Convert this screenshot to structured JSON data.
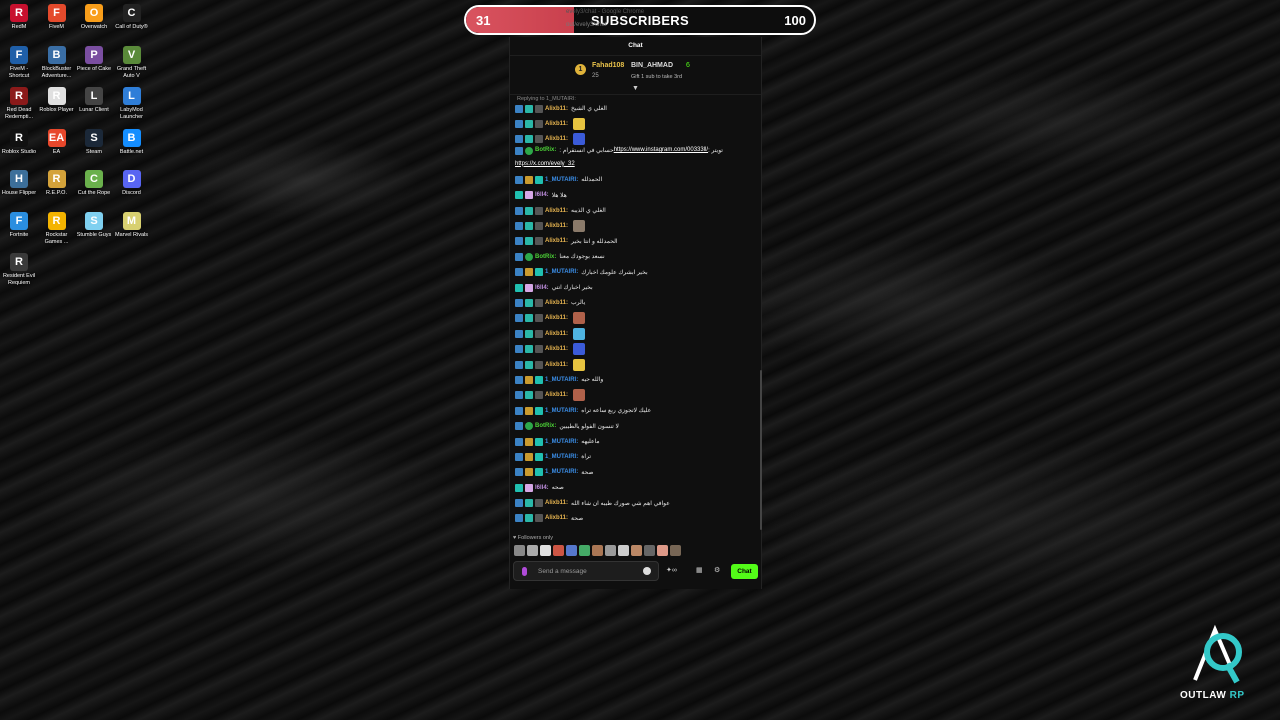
{
  "desktop": [
    {
      "label": "RedM",
      "color": "#c8102e",
      "glyph": "R"
    },
    {
      "label": "FiveM",
      "color": "#e44a2c",
      "glyph": "F"
    },
    {
      "label": "Overwatch",
      "color": "#f99e1a",
      "glyph": "O"
    },
    {
      "label": "Call of Duty®",
      "color": "#222222",
      "glyph": "C"
    },
    {
      "label": "FiveM - Shortcut",
      "color": "#1f5fa8",
      "glyph": "F"
    },
    {
      "label": "BlockBuster Adventure...",
      "color": "#3a6ea5",
      "glyph": "B"
    },
    {
      "label": "Piece of Cake",
      "color": "#7a4ea0",
      "glyph": "P"
    },
    {
      "label": "Grand Theft Auto V",
      "color": "#5a8a3a",
      "glyph": "V"
    },
    {
      "label": "Red Dead Redempti...",
      "color": "#8b1a1a",
      "glyph": "R"
    },
    {
      "label": "Roblox Player",
      "color": "#e0e0e0",
      "glyph": "R"
    },
    {
      "label": "Lunar Client",
      "color": "#444444",
      "glyph": "L"
    },
    {
      "label": "LabyMod Launcher",
      "color": "#2f7ed8",
      "glyph": "L"
    },
    {
      "label": "Roblox Studio",
      "color": "#111111",
      "glyph": "R"
    },
    {
      "label": "EA",
      "color": "#e8472b",
      "glyph": "EA"
    },
    {
      "label": "Steam",
      "color": "#1b2838",
      "glyph": "S"
    },
    {
      "label": "Battle.net",
      "color": "#148eff",
      "glyph": "B"
    },
    {
      "label": "House Flipper",
      "color": "#3c6f9a",
      "glyph": "H"
    },
    {
      "label": "R.E.P.O.",
      "color": "#d4a23a",
      "glyph": "R"
    },
    {
      "label": "Cut the Rope",
      "color": "#6ab04c",
      "glyph": "C"
    },
    {
      "label": "Discord",
      "color": "#5865f2",
      "glyph": "D"
    },
    {
      "label": "Fortnite",
      "color": "#2a8ee0",
      "glyph": "F"
    },
    {
      "label": "Rockstar Games ...",
      "color": "#f4b400",
      "glyph": "R"
    },
    {
      "label": "Stumble Guys",
      "color": "#7fd0f0",
      "glyph": "S"
    },
    {
      "label": "Marvel Rivals",
      "color": "#d8d070",
      "glyph": "M"
    },
    {
      "label": "Resident Evil Requiem",
      "color": "#3a3a3a",
      "glyph": "R"
    }
  ],
  "subscribers": {
    "current": "31",
    "title": "SUBSCRIBERS",
    "goal": "100",
    "progress": 0.31
  },
  "ghost": {
    "url": "out/evely3/chat",
    "title": "evely3/chat - Google Chrome"
  },
  "chat": {
    "header": "Chat",
    "pinned": {
      "name1": "Fahad108",
      "count1": "25",
      "name2": "BIN_AHMAD",
      "count2": "6",
      "gift": "Gift 1 sub to take 3rd"
    },
    "reply": "Replying to 1_MUTAIRI:",
    "messages": [
      {
        "user": "Alixb11:",
        "color": "#e6b450",
        "text": "الغلي ي الشيخ",
        "badges": [
          "b-blue",
          "b-cyan",
          "b-grey"
        ],
        "emote": ""
      },
      {
        "user": "Alixb11:",
        "color": "#e6b450",
        "text": "",
        "badges": [
          "b-blue",
          "b-cyan",
          "b-grey"
        ],
        "emote": "#e6c340"
      },
      {
        "user": "Alixb11:",
        "color": "#e6b450",
        "text": "",
        "badges": [
          "b-blue",
          "b-cyan",
          "b-grey"
        ],
        "emote": "#3b5bd8"
      },
      {
        "user": "1_MUTAIRI:",
        "color": "#3b8ee8",
        "text": "الحمدلله",
        "badges": [
          "b-blue",
          "b-crown",
          "b-teal"
        ],
        "emote": ""
      },
      {
        "user": "l6ll4:",
        "color": "#c08fe0",
        "text": "هلا هلا",
        "badges": [
          "b-teal",
          "b-pink"
        ],
        "emote": ""
      },
      {
        "user": "Alixb11:",
        "color": "#e6b450",
        "text": "الغلي ي الذيبه",
        "badges": [
          "b-blue",
          "b-cyan",
          "b-grey"
        ],
        "emote": ""
      },
      {
        "user": "Alixb11:",
        "color": "#e6b450",
        "text": "",
        "badges": [
          "b-blue",
          "b-cyan",
          "b-grey"
        ],
        "emote": "#8a7a6a"
      },
      {
        "user": "Alixb11:",
        "color": "#e6b450",
        "text": "الحمدلله و انتا بخير",
        "badges": [
          "b-blue",
          "b-cyan",
          "b-grey"
        ],
        "emote": ""
      },
      {
        "user": "BotRix:",
        "color": "#4cd137",
        "text": "نسعد بوجودك معنا",
        "badges": [
          "b-blue",
          "b-green"
        ],
        "emote": ""
      },
      {
        "user": "1_MUTAIRI:",
        "color": "#3b8ee8",
        "text": "بخير ابشرك علومك اخبارك",
        "badges": [
          "b-blue",
          "b-crown",
          "b-teal"
        ],
        "emote": ""
      },
      {
        "user": "l6ll4:",
        "color": "#c08fe0",
        "text": "بخير اخبارك انتي",
        "badges": [
          "b-teal",
          "b-pink"
        ],
        "emote": ""
      },
      {
        "user": "Alixb11:",
        "color": "#e6b450",
        "text": "يالرب",
        "badges": [
          "b-blue",
          "b-cyan",
          "b-grey"
        ],
        "emote": ""
      },
      {
        "user": "Alixb11:",
        "color": "#e6b450",
        "text": "",
        "badges": [
          "b-blue",
          "b-cyan",
          "b-grey"
        ],
        "emote": "#b0614a"
      },
      {
        "user": "Alixb11:",
        "color": "#e6b450",
        "text": "",
        "badges": [
          "b-blue",
          "b-cyan",
          "b-grey"
        ],
        "emote": "#4fb3e0"
      },
      {
        "user": "Alixb11:",
        "color": "#e6b450",
        "text": "",
        "badges": [
          "b-blue",
          "b-cyan",
          "b-grey"
        ],
        "emote": "#3b5bd8"
      },
      {
        "user": "Alixb11:",
        "color": "#e6b450",
        "text": "",
        "badges": [
          "b-blue",
          "b-cyan",
          "b-grey"
        ],
        "emote": "#e6c340"
      },
      {
        "user": "1_MUTAIRI:",
        "color": "#3b8ee8",
        "text": "والله حيه",
        "badges": [
          "b-blue",
          "b-crown",
          "b-teal"
        ],
        "emote": ""
      },
      {
        "user": "Alixb11:",
        "color": "#e6b450",
        "text": "",
        "badges": [
          "b-blue",
          "b-cyan",
          "b-grey"
        ],
        "emote": "#b0614a"
      },
      {
        "user": "1_MUTAIRI:",
        "color": "#3b8ee8",
        "text": "عليك لاتجوزي ربع ساعه تراه",
        "badges": [
          "b-blue",
          "b-crown",
          "b-teal"
        ],
        "emote": ""
      },
      {
        "user": "BotRix:",
        "color": "#4cd137",
        "text": "لا تنسون الفولو يالطيبين",
        "badges": [
          "b-blue",
          "b-green"
        ],
        "emote": ""
      },
      {
        "user": "1_MUTAIRI:",
        "color": "#3b8ee8",
        "text": "ماعليهه",
        "badges": [
          "b-blue",
          "b-crown",
          "b-teal"
        ],
        "emote": ""
      },
      {
        "user": "1_MUTAIRI:",
        "color": "#3b8ee8",
        "text": "تراة",
        "badges": [
          "b-blue",
          "b-crown",
          "b-teal"
        ],
        "emote": ""
      },
      {
        "user": "1_MUTAIRI:",
        "color": "#3b8ee8",
        "text": "صحة",
        "badges": [
          "b-blue",
          "b-crown",
          "b-teal"
        ],
        "emote": ""
      },
      {
        "user": "l6ll4:",
        "color": "#c08fe0",
        "text": "صحه",
        "badges": [
          "b-teal",
          "b-pink"
        ],
        "emote": ""
      },
      {
        "user": "Alixb11:",
        "color": "#e6b450",
        "text": "عوافي اهم شي صورك طيبه ان شاء الله",
        "badges": [
          "b-blue",
          "b-cyan",
          "b-grey"
        ],
        "emote": ""
      },
      {
        "user": "Alixb11:",
        "color": "#e6b450",
        "text": "صحة",
        "badges": [
          "b-blue",
          "b-cyan",
          "b-grey"
        ],
        "emote": ""
      }
    ],
    "botrix_link": {
      "user": "BotRix:",
      "text_before": ": حسابي في انستقرام",
      "url1": "https://www.instagram.com/00333ll/",
      "text_mid": ": تويتر",
      "url2": "https://x.com/evely_32"
    },
    "followers_only": "Followers only",
    "placeholder": "Send a message",
    "chat_button": "Chat",
    "emote_colors": [
      "#888888",
      "#aaaaaa",
      "#e0e0e0",
      "#cc5544",
      "#5577cc",
      "#44aa66",
      "#aa7755",
      "#999999",
      "#cccccc",
      "#bb8866",
      "#666666",
      "#dd9988",
      "#776655"
    ]
  },
  "logo": {
    "text": "OUTLAW",
    "accent": "RP"
  }
}
